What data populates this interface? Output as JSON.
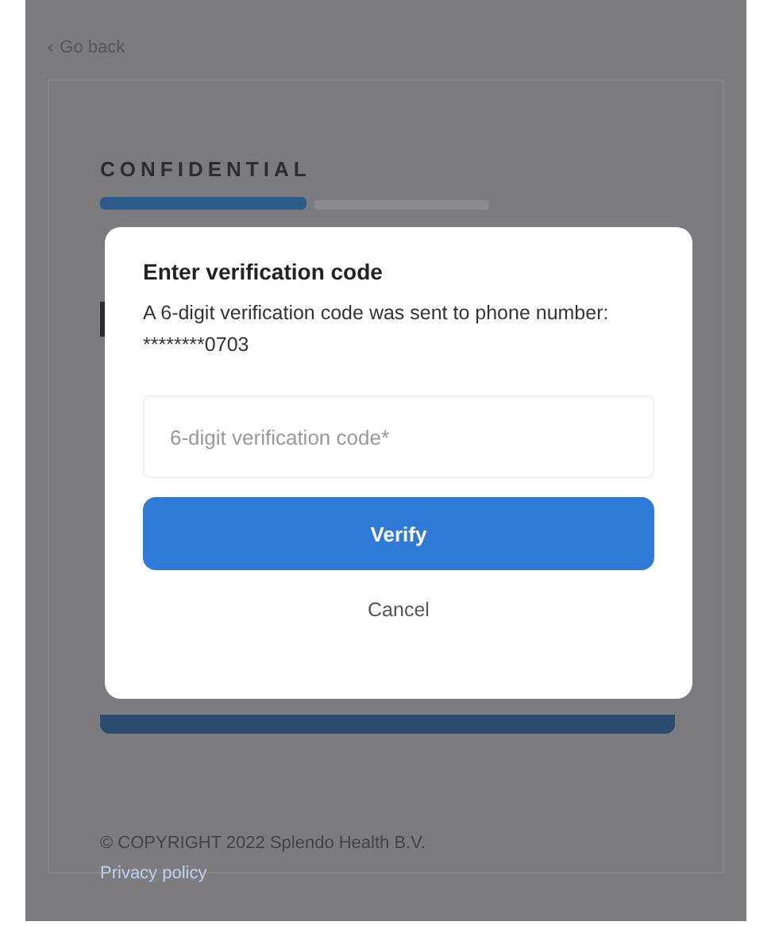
{
  "back_link": {
    "icon": "‹",
    "label": "Go back"
  },
  "header": {
    "label": "CONFIDENTIAL"
  },
  "dialog": {
    "title": "Enter verification code",
    "message": "A 6-digit verification code was sent to phone number: ********0703",
    "field": {
      "placeholder": "6-digit verification code*"
    },
    "primary_button": "Verify",
    "secondary_button": "Cancel"
  },
  "footer": {
    "copyright": "© COPYRIGHT 2022 Splendo Health B.V.",
    "privacy_link": "Privacy policy"
  }
}
